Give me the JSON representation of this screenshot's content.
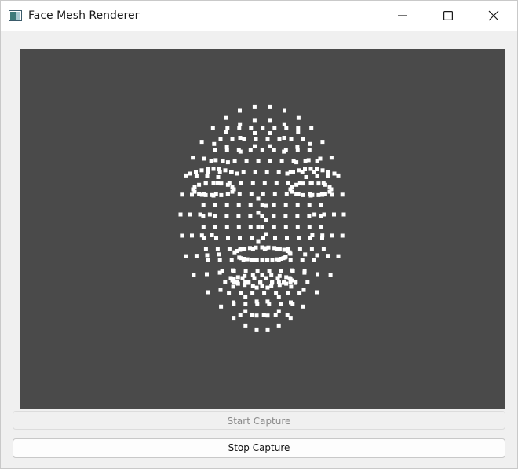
{
  "window": {
    "title": "Face Mesh Renderer",
    "icon": "app-window-icon",
    "controls": {
      "minimize_icon": "minimize-icon",
      "maximize_icon": "maximize-icon",
      "close_icon": "close-icon"
    }
  },
  "viewport": {
    "background": "#4a4a4a",
    "landmark_color": "#ffffff",
    "content": "face mesh landmark points"
  },
  "buttons": {
    "start_label": "Start Capture",
    "start_enabled": false,
    "stop_label": "Stop Capture",
    "stop_enabled": true
  }
}
